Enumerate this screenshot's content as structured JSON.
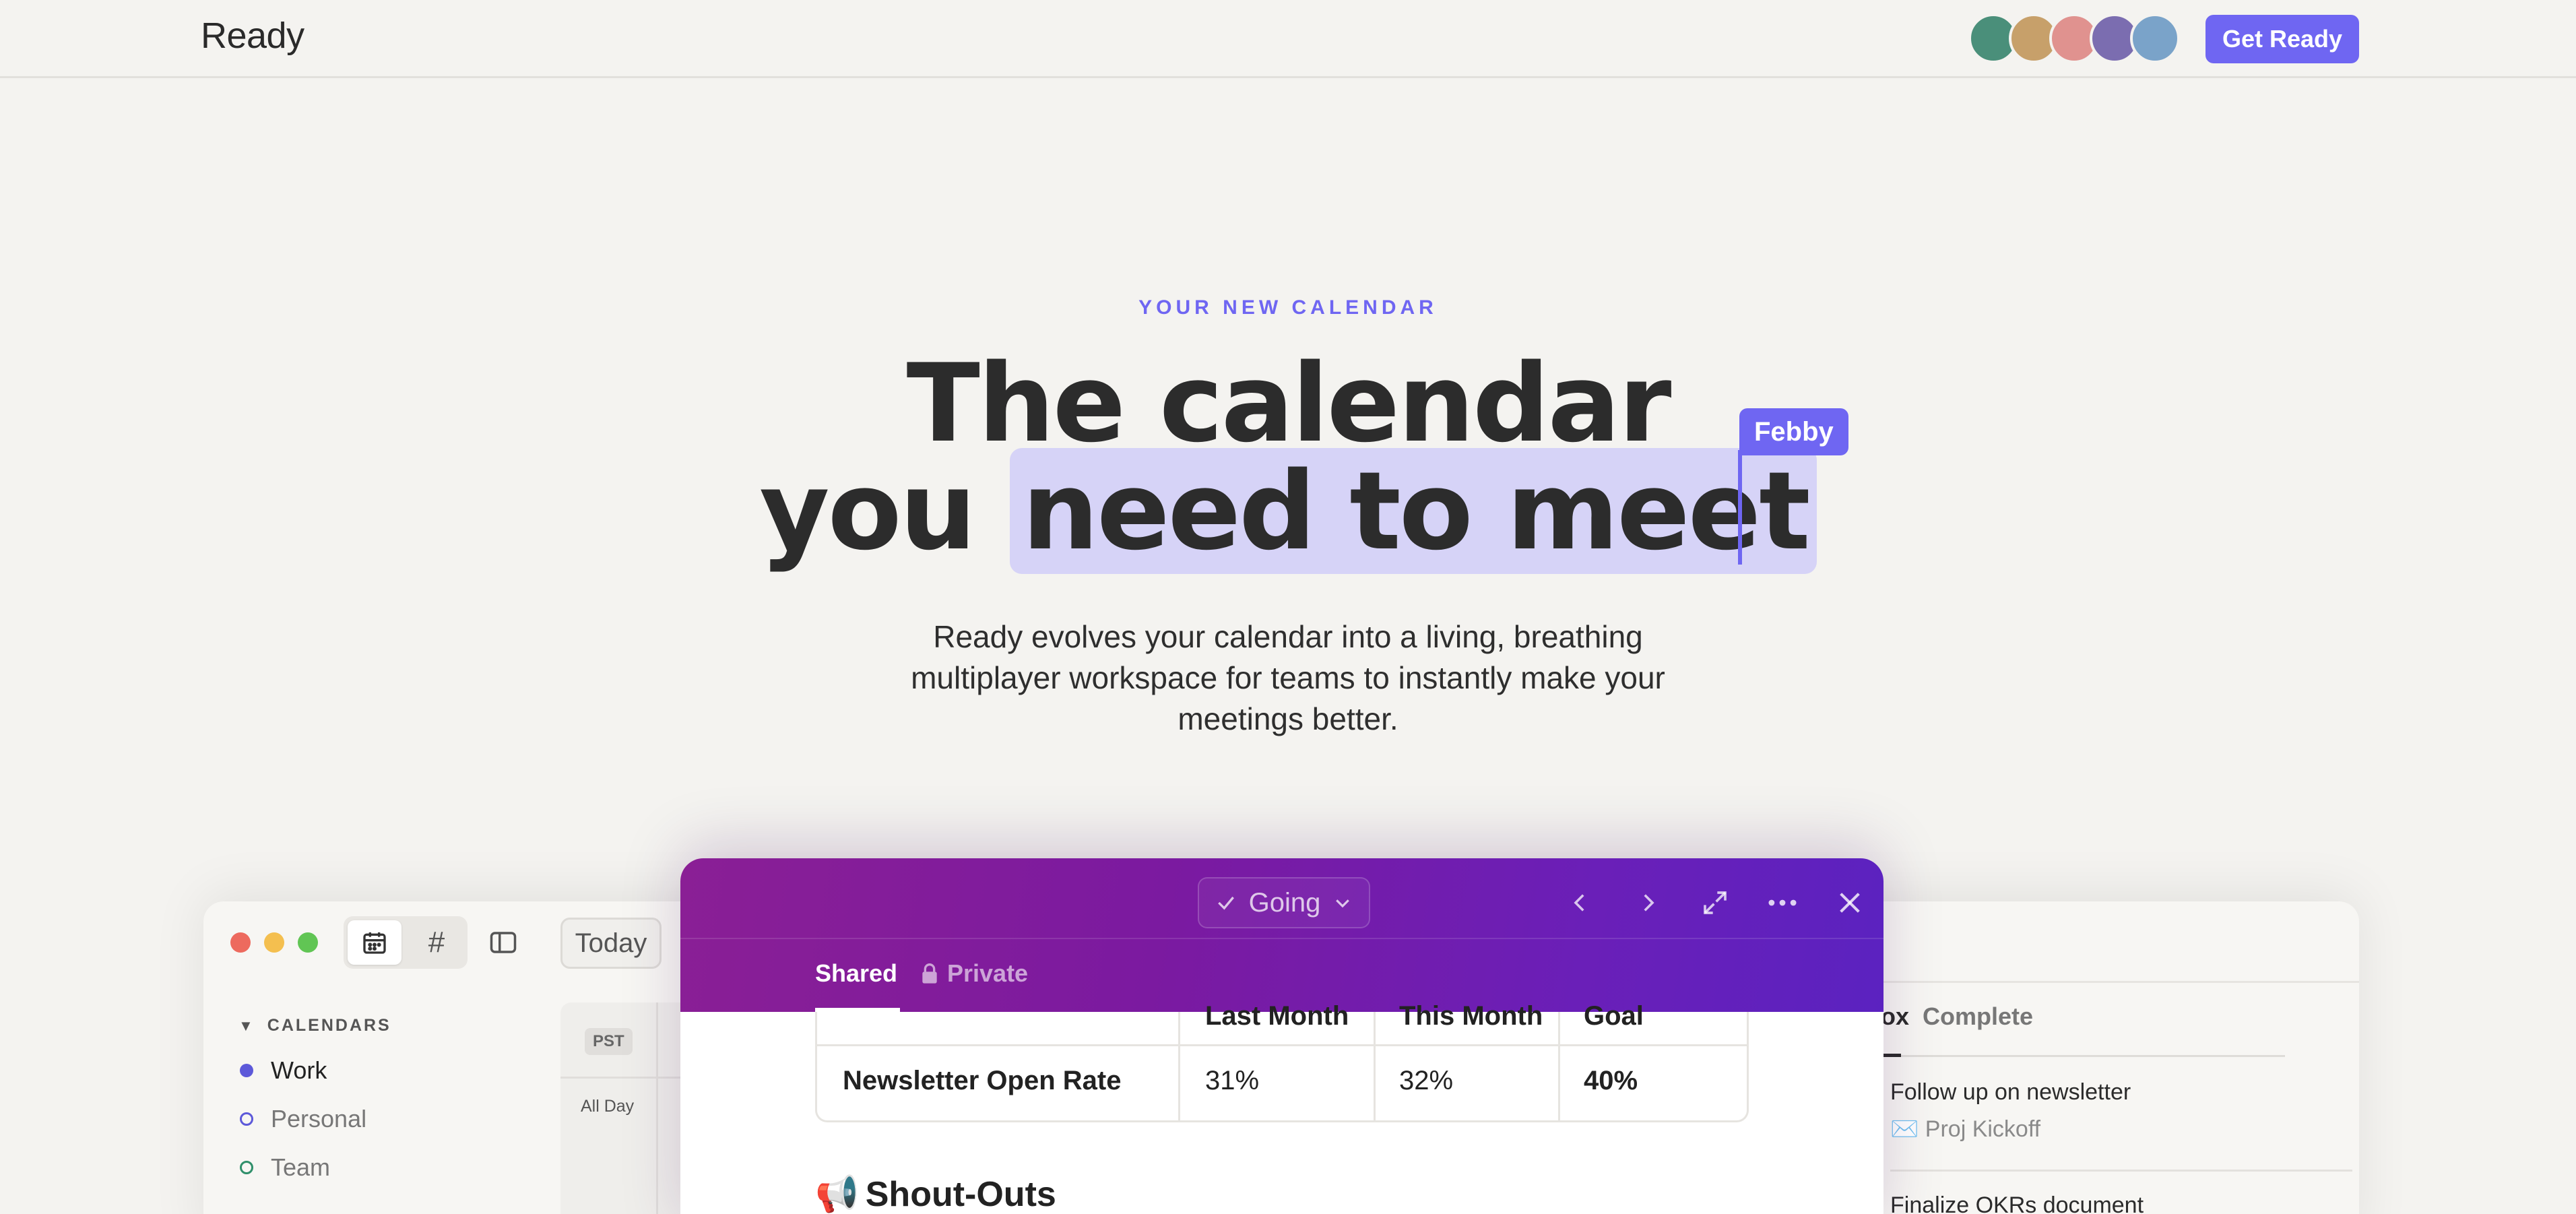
{
  "nav": {
    "logo": "Ready",
    "cta": "Get Ready",
    "avatars": [
      {
        "color": "#4a8f7a",
        "initial": ""
      },
      {
        "color": "#c7a06a",
        "initial": ""
      },
      {
        "color": "#e0928f",
        "initial": ""
      },
      {
        "color": "#7b6db0",
        "initial": ""
      },
      {
        "color": "#7aa3c9",
        "initial": ""
      }
    ]
  },
  "hero": {
    "eyebrow": "YOUR NEW CALENDAR",
    "line1": "The calendar",
    "line2_plain": "you",
    "line2_highlight": "need to meet",
    "cursor_name": "Febby",
    "subcopy": "Ready evolves your calendar into a living, breathing multiplayer workspace for teams to instantly make your meetings better."
  },
  "app": {
    "today_label": "Today",
    "calendars_heading": "CALENDARS",
    "calendars": [
      {
        "label": "Work",
        "color": "#5d59d9",
        "filled": true
      },
      {
        "label": "Personal",
        "color": "#5d59d9",
        "filled": false
      },
      {
        "label": "Team",
        "color": "#2f8f6a",
        "filled": false
      }
    ],
    "timezone": "PST",
    "all_day": "All Day",
    "right_tabs": {
      "inbox": "ox",
      "complete": "Complete"
    },
    "tasks": [
      {
        "title": "Follow up on newsletter",
        "sub": "✉️ Proj Kickoff"
      },
      {
        "title": "Finalize OKRs document",
        "sub": ""
      }
    ]
  },
  "modal": {
    "rsvp": "Going",
    "tabs": {
      "shared": "Shared",
      "private": "Private"
    },
    "table": {
      "headers": [
        "",
        "Last Month",
        "This Month",
        "Goal"
      ],
      "row": [
        "Newsletter Open Rate",
        "31%",
        "32%",
        "40%"
      ]
    },
    "section_title": "Shout-Outs",
    "section_icon": "📢"
  },
  "colors": {
    "accent": "#6f66f2",
    "highlight": "#d6d3f7",
    "modal_gradient_start": "#8a1f95",
    "modal_gradient_end": "#5b22c0"
  }
}
